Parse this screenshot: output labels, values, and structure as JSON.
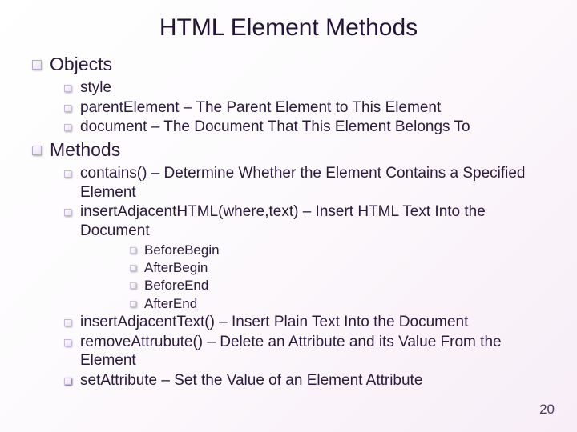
{
  "title": "HTML Element Methods",
  "sections": [
    {
      "heading": "Objects",
      "items": [
        "style",
        "parentElement – The Parent Element to This Element",
        "document – The Document That This Element Belongs To"
      ]
    },
    {
      "heading": "Methods",
      "items": [
        "contains() – Determine Whether the Element Contains a Specified Element",
        "insertAdjacentHTML(where,text) – Insert HTML Text Into the Document"
      ],
      "subitems": [
        "BeforeBegin",
        "AfterBegin",
        "BeforeEnd",
        "AfterEnd"
      ],
      "items2": [
        "insertAdjacentText() – Insert Plain Text Into the Document",
        "removeAttrubute() – Delete an Attribute and its Value From the Element",
        "",
        "setAttribute – Set the Value of an Element Attribute"
      ]
    }
  ],
  "page_number": "20"
}
